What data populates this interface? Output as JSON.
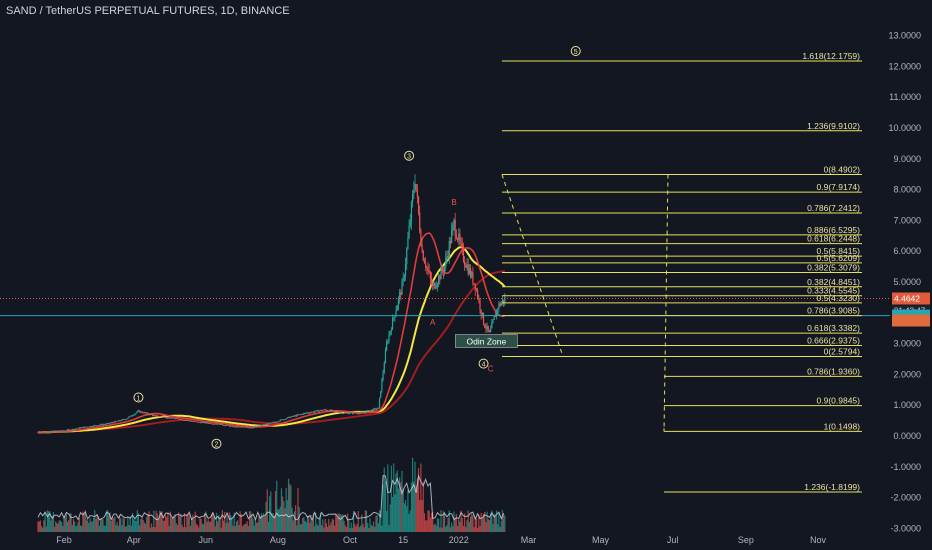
{
  "header": {
    "title": "SAND / TetherUS PERPETUAL FUTURES, 1D, BINANCE"
  },
  "chart_data": {
    "type": "candlestick",
    "y_axis": {
      "min": -2.0,
      "max": 13.0,
      "ticks": [
        "13.0000",
        "12.0000",
        "11.0000",
        "10.0000",
        "9.0000",
        "8.0000",
        "7.0000",
        "6.0000",
        "5.0000",
        "4.0000",
        "3.0000",
        "2.0000",
        "1.0000",
        "0.0000",
        "-1.0000",
        "-2.0000",
        "-3.0000"
      ],
      "tick_values": [
        13,
        12,
        11,
        10,
        9,
        8,
        7,
        6,
        5,
        4,
        3,
        2,
        1,
        0,
        -1,
        -2,
        -3
      ]
    },
    "x_axis": {
      "ticks": [
        "Feb",
        "Apr",
        "Jun",
        "Aug",
        "Oct",
        "15",
        "2022",
        "Mar",
        "May",
        "Jul",
        "Sep",
        "Nov"
      ],
      "tick_dates": [
        "2021-02-01",
        "2021-04-01",
        "2021-06-01",
        "2021-08-01",
        "2021-10-01",
        "2021-11-15",
        "2022-01-01",
        "2022-03-01",
        "2022-05-01",
        "2022-07-01",
        "2022-09-01",
        "2022-11-01"
      ]
    },
    "price_path": [
      [
        "2021-01-10",
        0.12
      ],
      [
        "2021-02-01",
        0.17
      ],
      [
        "2021-02-20",
        0.3
      ],
      [
        "2021-03-10",
        0.4
      ],
      [
        "2021-03-25",
        0.55
      ],
      [
        "2021-04-05",
        0.8
      ],
      [
        "2021-04-20",
        0.65
      ],
      [
        "2021-05-10",
        0.55
      ],
      [
        "2021-05-25",
        0.45
      ],
      [
        "2021-06-10",
        0.4
      ],
      [
        "2021-06-25",
        0.3
      ],
      [
        "2021-07-10",
        0.28
      ],
      [
        "2021-07-25",
        0.4
      ],
      [
        "2021-08-10",
        0.6
      ],
      [
        "2021-08-25",
        0.75
      ],
      [
        "2021-09-10",
        0.85
      ],
      [
        "2021-09-25",
        0.75
      ],
      [
        "2021-10-10",
        0.75
      ],
      [
        "2021-10-25",
        0.9
      ],
      [
        "2021-11-01",
        3.0
      ],
      [
        "2021-11-08",
        4.0
      ],
      [
        "2021-11-15",
        5.0
      ],
      [
        "2021-11-25",
        8.4
      ],
      [
        "2021-12-01",
        6.0
      ],
      [
        "2021-12-10",
        4.8
      ],
      [
        "2021-12-20",
        5.5
      ],
      [
        "2021-12-28",
        6.9
      ],
      [
        "2022-01-05",
        5.8
      ],
      [
        "2022-01-15",
        4.9
      ],
      [
        "2022-01-22",
        3.7
      ],
      [
        "2022-01-27",
        3.3
      ],
      [
        "2022-02-03",
        4.2
      ],
      [
        "2022-02-09",
        4.46
      ]
    ],
    "current_price": {
      "value": 4.4642,
      "label": "4.4642",
      "countdown": "01:43:47"
    },
    "odin_zone": {
      "label": "Odin Zone",
      "date": "2022-01-10",
      "price": 3.1
    },
    "wave_labels": [
      {
        "label": "1",
        "date": "2021-04-05",
        "price": 1.25
      },
      {
        "label": "2",
        "date": "2021-06-10",
        "price": -0.25
      },
      {
        "label": "3",
        "date": "2021-11-20",
        "price": 9.1
      },
      {
        "label": "4",
        "date": "2022-01-22",
        "price": 2.35
      },
      {
        "label": "5",
        "date": "2022-04-10",
        "price": 12.5
      }
    ],
    "wave_letters": [
      {
        "label": "A",
        "date": "2021-12-10",
        "price": 3.6
      },
      {
        "label": "B",
        "date": "2021-12-28",
        "price": 7.5
      },
      {
        "label": "C",
        "date": "2022-01-28",
        "price": 2.1
      }
    ],
    "fib_levels_a": [
      {
        "label": "1.618(12.1759)",
        "value": 12.1759
      },
      {
        "label": "1.236(9.9102)",
        "value": 9.9102
      },
      {
        "label": "0(8.4902)",
        "value": 8.4902
      },
      {
        "label": "0.9(7.9174)",
        "value": 7.9174
      },
      {
        "label": "0.786(7.2412)",
        "value": 7.2412
      },
      {
        "label": "0.886(6.5295)",
        "value": 6.5295
      },
      {
        "label": "0.618(6.2448)",
        "value": 6.2448
      },
      {
        "label": "0.5(5.8415)",
        "value": 5.8415
      },
      {
        "label": "0.5(5.6209)",
        "value": 5.6209
      },
      {
        "label": "0.382(5.3079)",
        "value": 5.3079
      },
      {
        "label": "0.382(4.8451)",
        "value": 4.8451
      },
      {
        "label": "0.333(4.5545)",
        "value": 4.5545
      },
      {
        "label": "0.5(4.3230)",
        "value": 4.323
      },
      {
        "label": "0.786(3.9085)",
        "value": 3.9085
      },
      {
        "label": "0.618(3.3382)",
        "value": 3.3382
      },
      {
        "label": "0.666(2.9375)",
        "value": 2.9375
      },
      {
        "label": "0(2.5794)",
        "value": 2.5794
      }
    ],
    "fib_levels_b": [
      {
        "label": "0.786(1.9360)",
        "value": 1.936
      },
      {
        "label": "0.9(0.9845)",
        "value": 0.9845
      },
      {
        "label": "1(0.1498)",
        "value": 0.1498
      },
      {
        "label": "1.236(-1.8199)",
        "value": -1.8199
      }
    ],
    "colors": {
      "background": "#131722",
      "fib": "#e6e05a",
      "price_line": "#e05a3c",
      "cyan_line": "#26a6b8",
      "ma_yellow": "#f5e642",
      "ma_red": "#e03c3c",
      "ma_dark_red": "#a01e1e",
      "volume_up": "#26a69a",
      "volume_down": "#ef5350",
      "axis_text": "#b2b5be"
    }
  }
}
